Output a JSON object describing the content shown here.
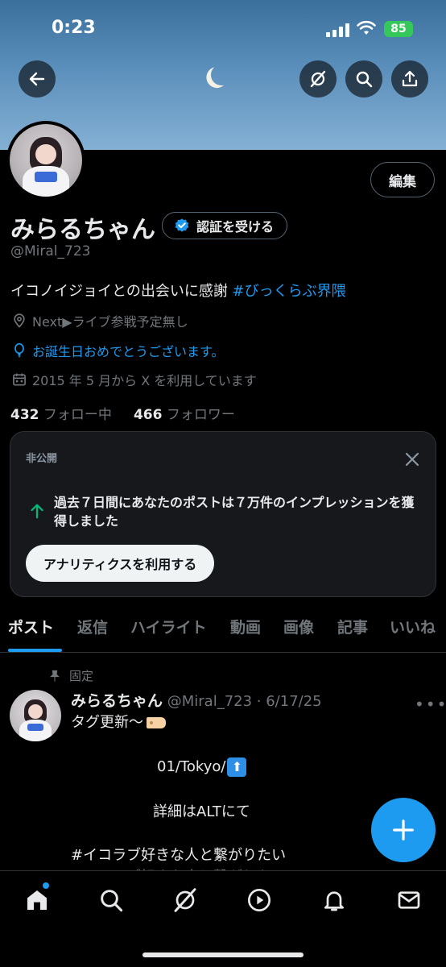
{
  "status_bar": {
    "time": "0:23",
    "battery": "85"
  },
  "header": {
    "back_icon": "arrow-left-icon",
    "actions": [
      "grok-icon",
      "search-icon",
      "share-icon"
    ]
  },
  "profile": {
    "edit_label": "編集",
    "name": "みらるちゃん",
    "verify_label": "認証を受ける",
    "handle": "@Miral_723",
    "bio_text": "イコノイジョイとの出会いに感謝 ",
    "bio_hashtag": "#びっくらぶ界隈",
    "location": "Next▶ライブ参戦予定無し",
    "birthday": "お誕生日おめでとうございます。",
    "joined": "2015 年 5 月から X を利用しています",
    "following_count": "432",
    "following_label": " フォロー中",
    "followers_count": "466",
    "followers_label": " フォロワー"
  },
  "analytics_card": {
    "label": "非公開",
    "text": "過去７日間にあなたのポストは７万件のインプレッションを獲得しました",
    "button": "アナリティクスを利用する"
  },
  "tabs": [
    "ポスト",
    "返信",
    "ハイライト",
    "動画",
    "画像",
    "記事",
    "いいね"
  ],
  "pinned_post": {
    "pinned_label": "固定",
    "author": "みらるちゃん",
    "meta": " @Miral_723 · 6/17/25",
    "line1": "タグ更新〜",
    "line2": "01/Tokyo/",
    "line3": "詳細はALTにて",
    "line4": "#イコラブ好きな人と繋がりたい",
    "line5": "#イコラブ好きな人と繋がりたい"
  },
  "colors": {
    "accent": "#1d9bf0",
    "background": "#000000",
    "muted": "#71767b"
  },
  "bottom_nav": [
    "home-icon",
    "search-icon",
    "grok-icon",
    "play-icon",
    "bell-icon",
    "mail-icon"
  ]
}
